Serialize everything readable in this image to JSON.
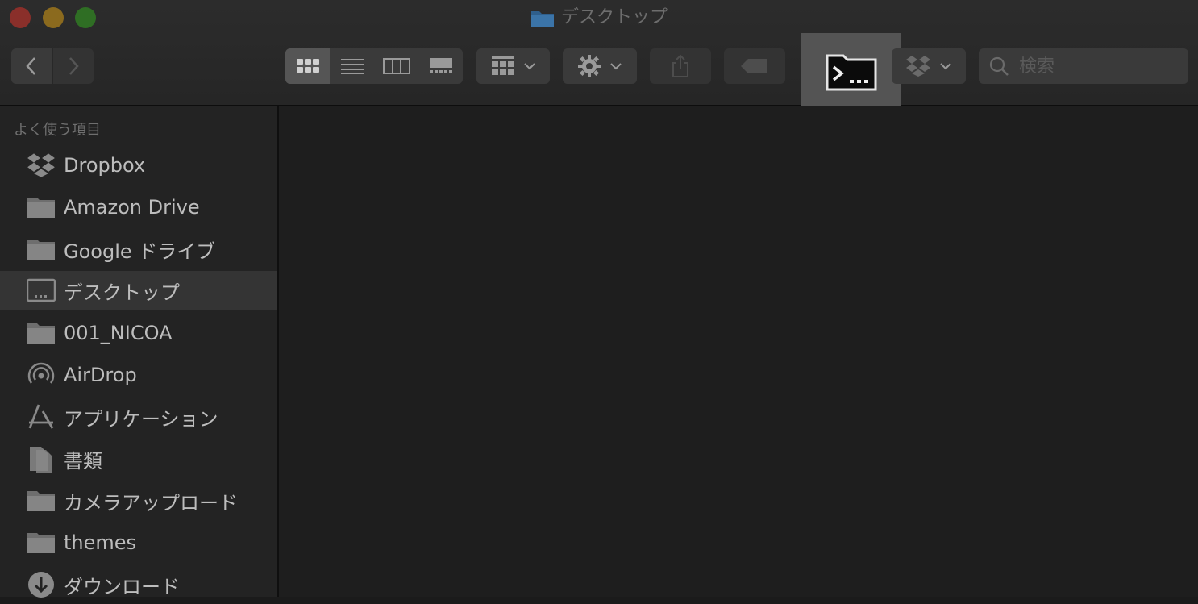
{
  "window": {
    "title": "デスクトップ"
  },
  "toolbar": {
    "search_placeholder": "検索"
  },
  "sidebar": {
    "header": "よく使う項目",
    "items": [
      {
        "label": "Dropbox",
        "icon": "dropbox-icon"
      },
      {
        "label": "Amazon Drive",
        "icon": "folder-icon"
      },
      {
        "label": "Google ドライブ",
        "icon": "folder-icon"
      },
      {
        "label": "デスクトップ",
        "icon": "desktop-icon",
        "selected": true
      },
      {
        "label": "001_NICOA",
        "icon": "folder-icon"
      },
      {
        "label": "AirDrop",
        "icon": "airdrop-icon"
      },
      {
        "label": "アプリケーション",
        "icon": "applications-icon"
      },
      {
        "label": "書類",
        "icon": "documents-icon"
      },
      {
        "label": "カメラアップロード",
        "icon": "folder-icon"
      },
      {
        "label": "themes",
        "icon": "folder-icon"
      },
      {
        "label": "ダウンロード",
        "icon": "downloads-icon"
      }
    ]
  },
  "colors": {
    "window_bg": "#1c1c1c",
    "sidebar_bg": "#232323",
    "selected_bg": "#343434",
    "close": "#8a2f2a",
    "minimize": "#8b6a1e",
    "zoom": "#2f6e24"
  }
}
